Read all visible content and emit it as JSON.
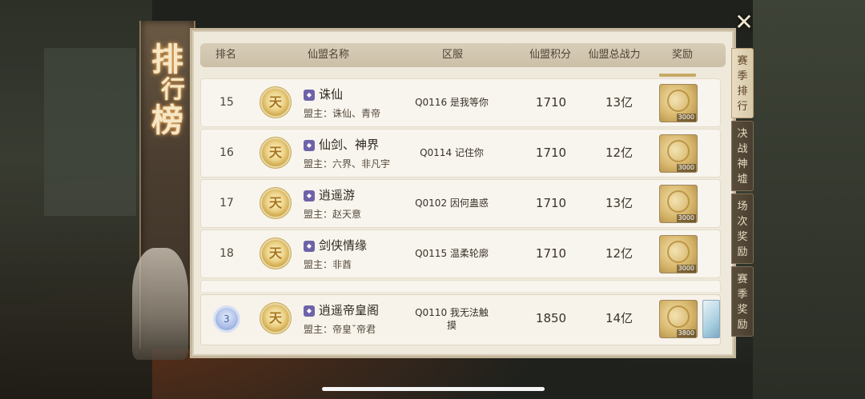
{
  "title": [
    "排",
    "行",
    "榜"
  ],
  "close_icon": "close-icon",
  "headers": {
    "rank": "排名",
    "name": "仙盟名称",
    "server": "区服",
    "score": "仙盟积分",
    "power": "仙盟总战力",
    "reward": "奖励"
  },
  "rows": [
    {
      "rank": "15",
      "emblem": "天",
      "name": "诛仙",
      "leader": "盟主：诛仙、青帝",
      "server": "Q0116 是我等你",
      "score": "1710",
      "power": "13亿",
      "reward_qty": "3000"
    },
    {
      "rank": "16",
      "emblem": "天",
      "name": "仙剑、神界",
      "leader": "盟主：六界、非凡宇",
      "server": "Q0114 记住你",
      "score": "1710",
      "power": "12亿",
      "reward_qty": "3000"
    },
    {
      "rank": "17",
      "emblem": "天",
      "name": "逍遥游",
      "leader": "盟主：赵天意",
      "server": "Q0102 因何蛊惑",
      "score": "1710",
      "power": "13亿",
      "reward_qty": "3000"
    },
    {
      "rank": "18",
      "emblem": "天",
      "name": "剑侠情缘",
      "leader": "盟主：非酋",
      "server": "Q0115 温柔轮廓",
      "score": "1710",
      "power": "12亿",
      "reward_qty": "3000"
    }
  ],
  "my_guild": {
    "rank": "3",
    "emblem": "天",
    "name": "逍遥帝皇阁",
    "leader": "盟主：帝皇ˇ帝君",
    "server_line1": "Q0110 我无法触",
    "server_line2": "摸",
    "score": "1850",
    "power": "14亿",
    "reward_qty": "3800"
  },
  "tabs": [
    {
      "label": [
        "赛",
        "季",
        "排",
        "行"
      ],
      "active": true
    },
    {
      "label": [
        "决",
        "战",
        "神",
        "墟"
      ],
      "active": false
    },
    {
      "label": [
        "场",
        "次",
        "奖",
        "励"
      ],
      "active": false
    },
    {
      "label": [
        "赛",
        "季",
        "奖",
        "励"
      ],
      "active": false
    }
  ]
}
